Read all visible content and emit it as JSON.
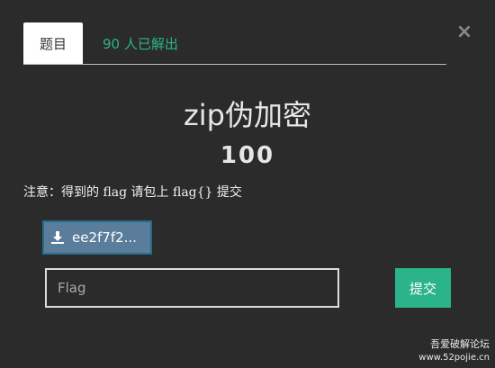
{
  "tabs": {
    "challenge_label": "题目",
    "solves_label": "90 人已解出"
  },
  "close": {
    "glyph": "×"
  },
  "challenge": {
    "name": "zip伪加密",
    "points": "100",
    "description": "注意：得到的 flag 请包上 flag{} 提交"
  },
  "download": {
    "filename": "ee2f7f2...",
    "icon": "download-icon"
  },
  "flag_input": {
    "placeholder": "Flag",
    "value": ""
  },
  "submit": {
    "label": "提交"
  },
  "watermark": {
    "line1": "吾爱破解论坛",
    "line2": "www.52pojie.cn"
  },
  "colors": {
    "background": "#2b2b2b",
    "accent": "#2bb38a",
    "download_bg": "#5b7d9c"
  }
}
